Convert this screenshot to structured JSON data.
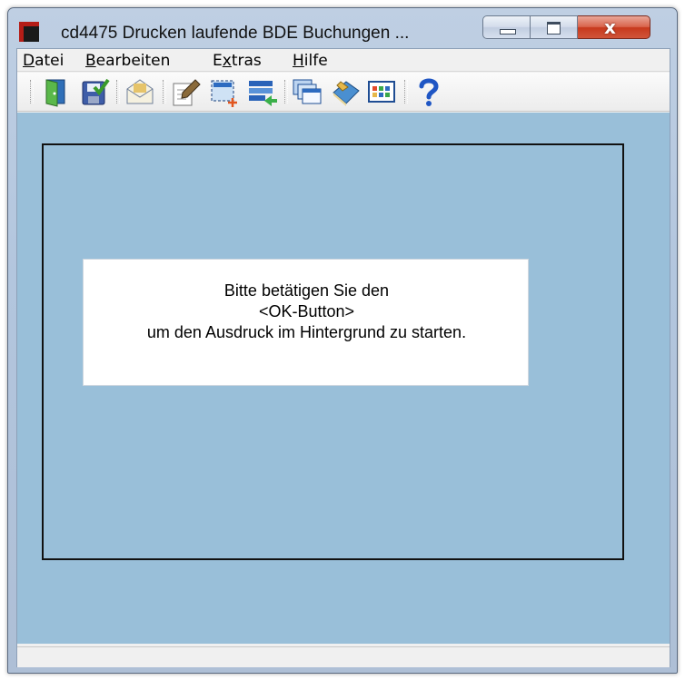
{
  "window": {
    "title": "cd4475 Drucken laufende BDE Buchungen ...",
    "accent_color": "#b51d17",
    "caption_buttons": {
      "minimize_icon": "minimize-icon",
      "maximize_icon": "maximize-icon",
      "close_glyph": "x"
    }
  },
  "menu": {
    "items": [
      {
        "first": "D",
        "rest": "atei"
      },
      {
        "first": "B",
        "rest": "earbeiten"
      },
      {
        "pre": "E",
        "ul": "x",
        "post": "tras"
      },
      {
        "first": "H",
        "rest": "ilfe"
      }
    ]
  },
  "toolbar": {
    "icons": [
      "exit-door-icon",
      "save-icon",
      "mail-icon",
      "edit-document-icon",
      "select-area-icon",
      "transfer-list-icon",
      "windows-icon",
      "book-icon",
      "grid-calendar-icon",
      "help-icon"
    ]
  },
  "message": {
    "line1": "Bitte betätigen Sie den",
    "line2": "<OK-Button>",
    "line3": "um den Ausdruck im Hintergrund zu starten."
  },
  "colors": {
    "workarea": "#99bfd9",
    "message_bg": "#ffffff"
  }
}
